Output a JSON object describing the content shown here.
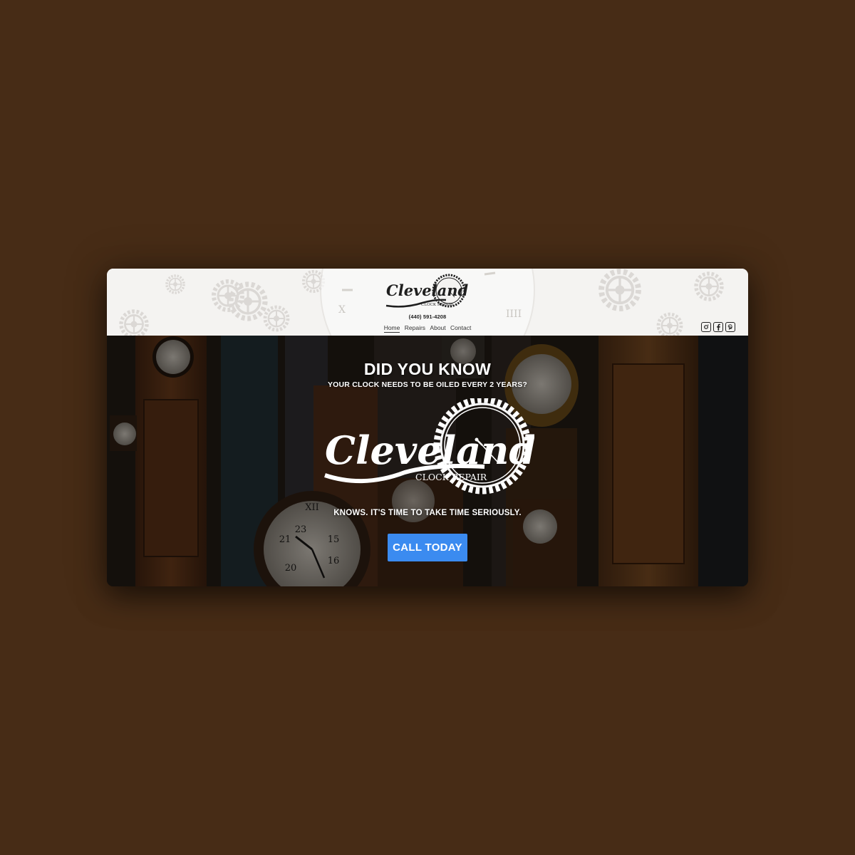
{
  "header": {
    "logo_script": "Cleveland",
    "logo_sub": "CLOCK REPAIR",
    "phone": "(440) 591-4208",
    "nav": [
      {
        "label": "Home"
      },
      {
        "label": "Repairs"
      },
      {
        "label": "About"
      },
      {
        "label": "Contact"
      }
    ],
    "social": [
      {
        "icon": "instagram-icon"
      },
      {
        "icon": "facebook-icon"
      },
      {
        "icon": "pinterest-icon"
      }
    ]
  },
  "hero": {
    "heading": "DID YOU KNOW",
    "subheading": "YOUR CLOCK NEEDS TO BE OILED EVERY 2 YEARS?",
    "logo_script": "Cleveland",
    "logo_sub": "CLOCK REPAIR",
    "tagline": "KNOWS. IT'S TIME TO TAKE TIME SERIOUSLY.",
    "cta_label": "CALL TODAY"
  },
  "colors": {
    "page_background": "#472c16",
    "cta": "#3b8bf0",
    "header_background": "#f4f3f1"
  }
}
